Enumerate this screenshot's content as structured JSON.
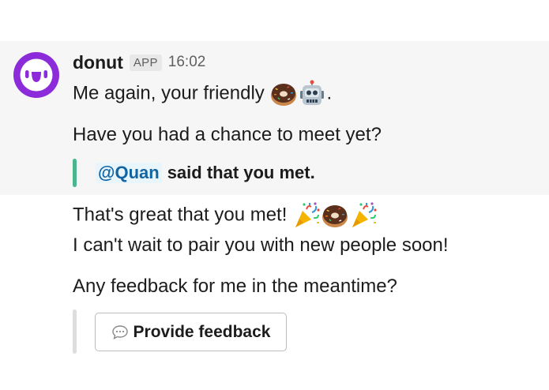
{
  "message": {
    "bot_name": "donut",
    "badge": "APP",
    "timestamp": "16:02",
    "line1": "Me again, your friendly",
    "line1_end": ".",
    "line2": "Have you had a chance to meet yet?",
    "quote": {
      "mention": "@Quan",
      "text": "said that you met."
    }
  },
  "followup": {
    "line1": "That's great that you met!",
    "line2": "I can't wait to pair you with new people soon!",
    "line3": "Any feedback for me in the meantime?",
    "button_label": "Provide feedback"
  },
  "colors": {
    "avatar": "#8b2bd9",
    "quote_bar": "#4db58d",
    "mention": "#1264a3",
    "highlight": "#f6f6f6"
  },
  "icons": {
    "avatar": "donut-bot-avatar-icon",
    "emoji1": "doughnut-emoji-icon",
    "emoji2": "robot-emoji-icon",
    "emoji3": "party-popper-emoji-icon",
    "emoji4": "doughnut-emoji-icon",
    "emoji5": "party-popper-emoji-icon",
    "button": "speech-bubble-icon"
  }
}
